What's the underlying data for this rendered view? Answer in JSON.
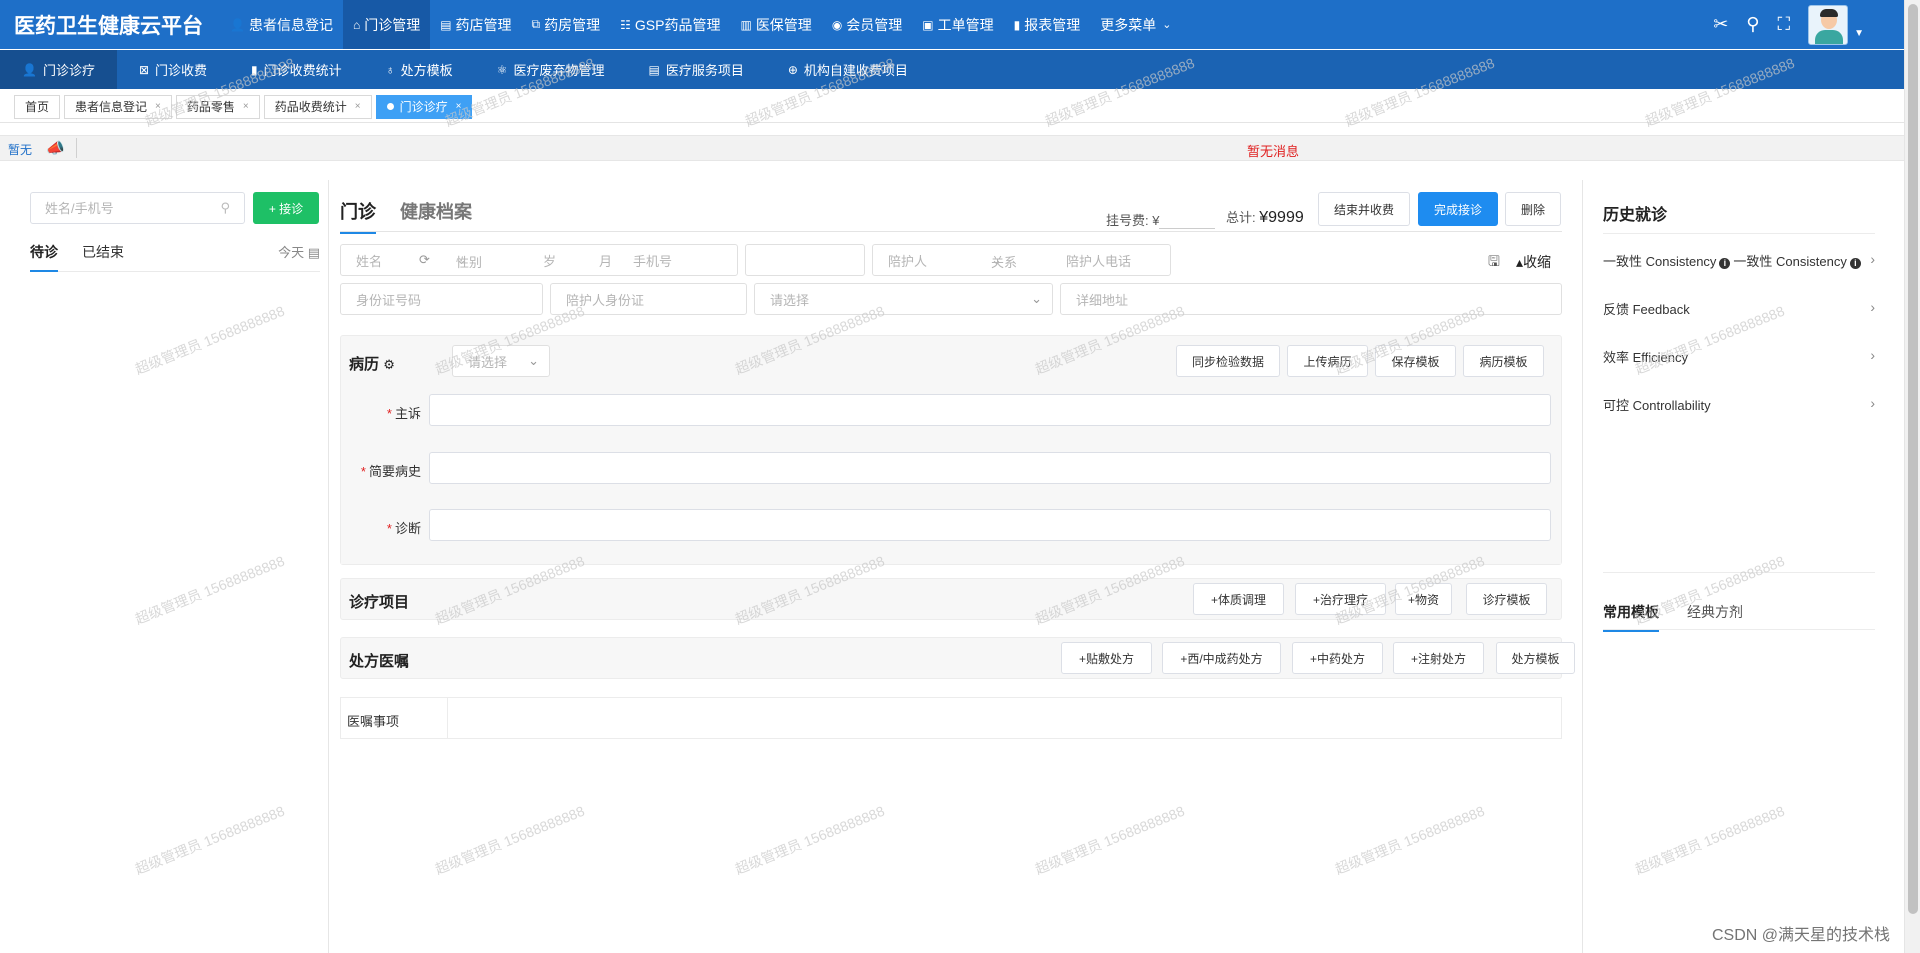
{
  "app": {
    "brand": "医药卫生健康云平台"
  },
  "topnav": [
    {
      "label": "患者信息登记",
      "icon": "user-icon",
      "glyph": "👤",
      "active": false
    },
    {
      "label": "门诊管理",
      "icon": "clinic-icon",
      "glyph": "⌂",
      "active": true
    },
    {
      "label": "药店管理",
      "icon": "store-icon",
      "glyph": "▤",
      "active": false
    },
    {
      "label": "药房管理",
      "icon": "pharmacy-icon",
      "glyph": "⧉",
      "active": false
    },
    {
      "label": "GSP药品管理",
      "icon": "list-icon",
      "glyph": "☷",
      "active": false
    },
    {
      "label": "医保管理",
      "icon": "book-icon",
      "glyph": "▥",
      "active": false
    },
    {
      "label": "会员管理",
      "icon": "github-icon",
      "glyph": "◉",
      "active": false
    },
    {
      "label": "工单管理",
      "icon": "ticket-icon",
      "glyph": "▣",
      "active": false
    },
    {
      "label": "报表管理",
      "icon": "chart-icon",
      "glyph": "▮",
      "active": false
    },
    {
      "label": "更多菜单",
      "icon": "chevron-down-icon",
      "glyph": "",
      "active": false
    }
  ],
  "topright_icons": [
    "scissors-icon",
    "search-icon",
    "fullscreen-icon"
  ],
  "subnav": [
    {
      "label": "门诊诊疗",
      "icon": "user-icon",
      "glyph": "👤",
      "active": true
    },
    {
      "label": "门诊收费",
      "icon": "receipt-icon",
      "glyph": "⊠",
      "active": false
    },
    {
      "label": "门诊收费统计",
      "icon": "bar-chart-icon",
      "glyph": "▮",
      "active": false
    },
    {
      "label": "处方模板",
      "icon": "template-icon",
      "glyph": "♁",
      "active": false
    },
    {
      "label": "医疗废弃物管理",
      "icon": "trash-icon",
      "glyph": "⚛",
      "active": false
    },
    {
      "label": "医疗服务项目",
      "icon": "document-icon",
      "glyph": "▤",
      "active": false
    },
    {
      "label": "机构自建收费项目",
      "icon": "globe-icon",
      "glyph": "⊕",
      "active": false
    }
  ],
  "tabs": [
    {
      "label": "首页",
      "closable": false,
      "active": false
    },
    {
      "label": "患者信息登记",
      "closable": true,
      "active": false
    },
    {
      "label": "药品零售",
      "closable": true,
      "active": false
    },
    {
      "label": "药品收费统计",
      "closable": true,
      "active": false
    },
    {
      "label": "门诊诊疗",
      "closable": true,
      "active": true
    }
  ],
  "notice": {
    "left": "暂无",
    "message": "暂无消息"
  },
  "left": {
    "search_placeholder": "姓名/手机号",
    "receive_button": "+ 接诊",
    "tabs": [
      "待诊",
      "已结束"
    ],
    "date_filter": "今天"
  },
  "center": {
    "tabs": [
      "门诊",
      "健康档案"
    ],
    "fee_label": "挂号费: ¥",
    "total_label": "总计:",
    "total_value": "¥9999",
    "buttons": {
      "end_and_charge": "结束并收费",
      "finish": "完成接诊",
      "delete": "删除"
    },
    "patient": {
      "name": "姓名",
      "gender": "性别",
      "age": "岁",
      "month": "月",
      "phone": "手机号",
      "companion": "陪护人",
      "relation": "关系",
      "companion_phone": "陪护人电话",
      "collapse": "收缩",
      "id_card": "身份证号码",
      "companion_id": "陪护人身份证",
      "select": "请选择",
      "address": "详细地址"
    },
    "record": {
      "title": "病历",
      "select": "请选择",
      "buttons": [
        "同步检验数据",
        "上传病历",
        "保存模板",
        "病历模板"
      ],
      "fields": [
        "主诉",
        "简要病史",
        "诊断"
      ]
    },
    "treatment": {
      "title": "诊疗项目",
      "buttons": [
        "+体质调理",
        "+治疗理疗",
        "+物资",
        "诊疗模板"
      ]
    },
    "prescription": {
      "title": "处方医嘱",
      "buttons": [
        "+贴敷处方",
        "+西/中成药处方",
        "+中药处方",
        "+注射处方",
        "处方模板"
      ]
    },
    "advice_label": "医嘱事项"
  },
  "right": {
    "title": "历史就诊",
    "items": [
      {
        "label": "一致性 Consistency",
        "label2": "一致性 Consistency"
      },
      {
        "label": "反馈 Feedback",
        "label2": ""
      },
      {
        "label": "效率 Efficiency",
        "label2": ""
      },
      {
        "label": "可控 Controllability",
        "label2": ""
      }
    ],
    "tabs": [
      "常用模板",
      "经典方剂"
    ]
  },
  "watermark": "超级管理员 15688888888",
  "csdn": "CSDN @满天星的技术栈",
  "colors": {
    "topbar": "#1e6fc8",
    "subbar": "#1b63b3",
    "primary": "#1e8cf0",
    "green": "#1ec066",
    "required": "#e02020"
  }
}
